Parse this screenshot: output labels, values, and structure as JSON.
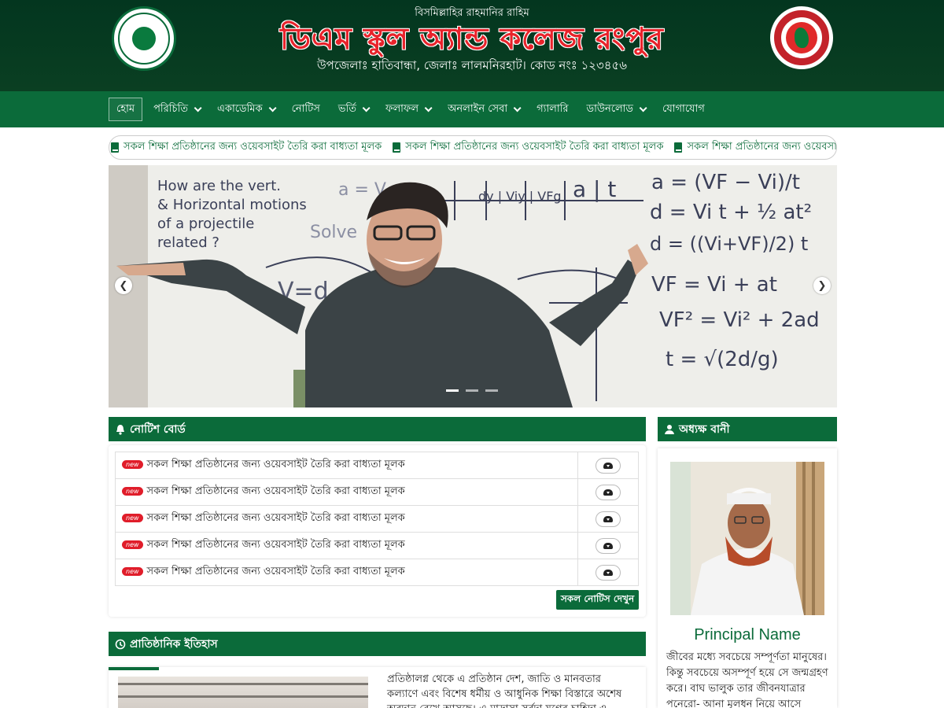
{
  "header": {
    "bismillah": "বিসমিল্লাহির রাহমানির রাহিম",
    "title": "ডিএম স্কুল অ্যান্ড কলেজ রংপুর",
    "address": "উপজেলাঃ হাতিবান্ধা, জেলাঃ লালমনিরহাট। কোড নংঃ ১২৩৪৫৬",
    "left_logo": "school-logo",
    "right_logo": "bangladesh-government-seal"
  },
  "nav": {
    "items": [
      {
        "label": "হোম",
        "active": true,
        "dropdown": false
      },
      {
        "label": "পরিচিতি",
        "dropdown": true
      },
      {
        "label": "একাডেমিক",
        "dropdown": true
      },
      {
        "label": "নোটিস",
        "dropdown": false
      },
      {
        "label": "ভর্তি",
        "dropdown": true
      },
      {
        "label": "ফলাফল",
        "dropdown": true
      },
      {
        "label": "অনলাইন সেবা",
        "dropdown": true
      },
      {
        "label": "গ্যালারি",
        "dropdown": false
      },
      {
        "label": "ডাউনলোড",
        "dropdown": true
      },
      {
        "label": "যোগাযোগ",
        "dropdown": false
      }
    ]
  },
  "ticker": {
    "items": [
      "সকল শিক্ষা প্রতিষ্ঠানের জন্য ওয়েবসাইট তৈরি করা বাধ্যতা মূলক",
      "সকল শিক্ষা প্রতিষ্ঠানের জন্য ওয়েবসাইট তৈরি করা বাধ্যতা মূলক",
      "সকল শিক্ষা প্রতিষ্ঠানের জন্য ওয়েবসাইট তৈরি করা বাধ্যতা মূলক"
    ]
  },
  "slider": {
    "board_text": [
      "How are the vert.",
      "& Horizontal motions",
      "of a projectile",
      "related ?"
    ],
    "formulas": [
      "a = (VF − Vi)/t",
      "d = Vi t + ½ at²",
      "d = ((Vi+VF)/2) t",
      "VF = Vi + at",
      "VF² = Vi² + 2ad",
      "t = √(2d/g)"
    ],
    "dots": 3,
    "active_dot": 0
  },
  "notice_board": {
    "title": "নোটিশ বোর্ড",
    "new_badge": "new",
    "notices": [
      "সকল শিক্ষা প্রতিষ্ঠানের জন্য ওয়েবসাইট তৈরি করা বাধ্যতা মূলক",
      "সকল শিক্ষা প্রতিষ্ঠানের জন্য ওয়েবসাইট তৈরি করা বাধ্যতা মূলক",
      "সকল শিক্ষা প্রতিষ্ঠানের জন্য ওয়েবসাইট তৈরি করা বাধ্যতা মূলক",
      "সকল শিক্ষা প্রতিষ্ঠানের জন্য ওয়েবসাইট তৈরি করা বাধ্যতা মূলক",
      "সকল শিক্ষা প্রতিষ্ঠানের জন্য ওয়েবসাইট তৈরি করা বাধ্যতা মূলক"
    ],
    "all_button": "সকল নোটিস দেখুন"
  },
  "principal": {
    "title": "অধ্যক্ষ বানী",
    "name": "Principal Name",
    "message": "জীবের মধ্যে সবচেয়ে সম্পূর্ণতা মানুষের। কিন্তু সবচেয়ে অসম্পূর্ণ হয়ে সে জন্মগ্রহণ করে। বাঘ ভালুক তার জীবনযাত্রার পনেরো- আনা মূলধন নিয়ে আসে"
  },
  "history": {
    "title": "প্রাতিষ্ঠানিক ইতিহাস",
    "text": "প্রতিষ্ঠালগ্ন থেকে এ প্রতিষ্ঠান দেশ, জাতি ও মানবতার কল্যাণে এবং বিশেষ ধর্মীয় ও আধুনিক শিক্ষা বিস্তারে অশেষ অবদান রেখে আসছে। এ মাদ্রাসা সর্বদা যুগের চাহিদা ও সময়ের দাবির"
  },
  "colors": {
    "header_bg": "#03361f",
    "nav_bg": "#0b6b3a",
    "title_red": "#e8232b",
    "badge_red": "#e01d2a"
  }
}
